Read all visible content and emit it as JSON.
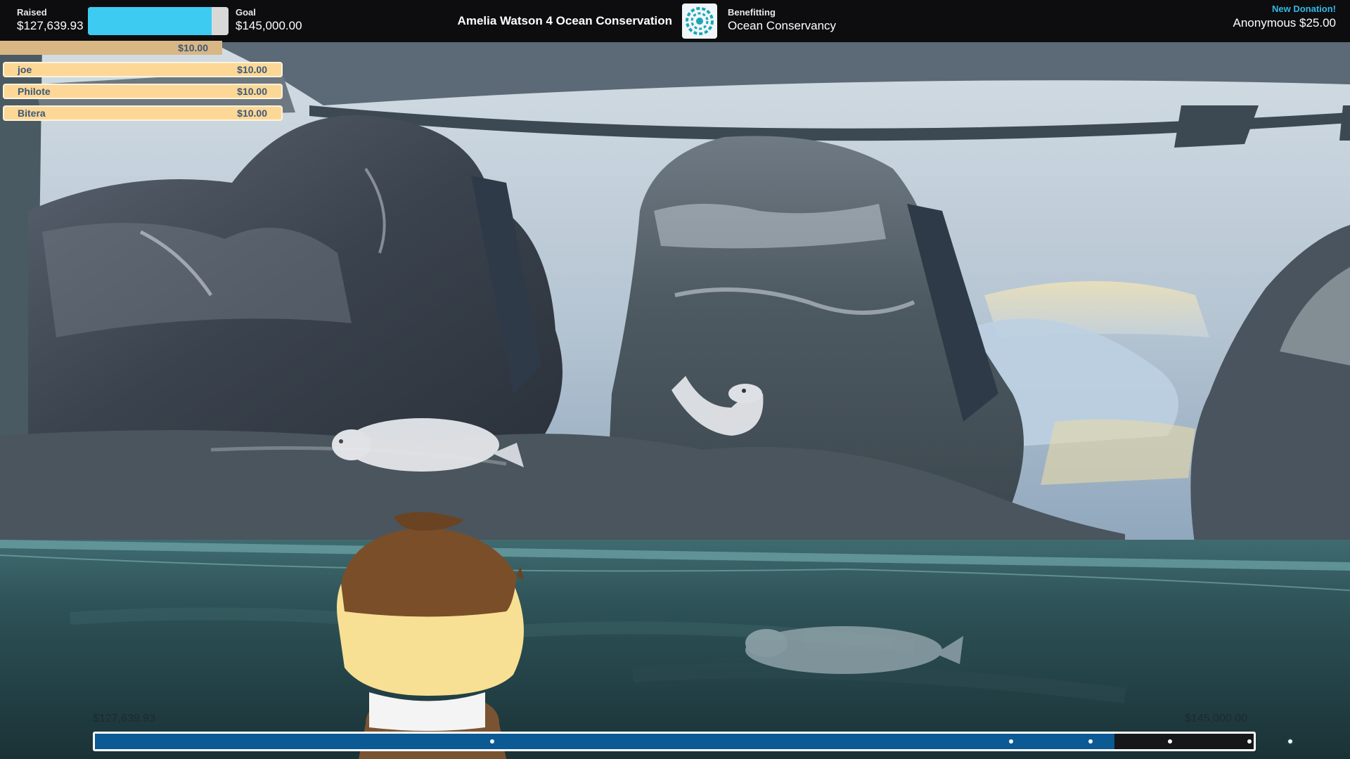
{
  "header": {
    "raised_label": "Raised",
    "raised_value": "$127,639.93",
    "goal_label": "Goal",
    "goal_value": "$145,000.00",
    "progress_fraction": 0.88,
    "stream_title": "Amelia Watson 4 Ocean Conservation",
    "logo_icon": "ocean-conservancy-logo-icon",
    "benefitting_label": "Benefitting",
    "benefitting_value": "Ocean Conservancy",
    "new_donation_label": "New Donation!",
    "new_donation_text": "Anonymous $25.00"
  },
  "donations": {
    "top_amount": "$10.00",
    "items": [
      {
        "name": "joe",
        "amount": "$10.00"
      },
      {
        "name": "Philote",
        "amount": "$10.00"
      },
      {
        "name": "Bitera",
        "amount": "$10.00"
      }
    ]
  },
  "progress": {
    "start_label": "$127,639.93",
    "end_label": "$145,000.00",
    "fill_fraction": 0.88
  },
  "colors": {
    "accent_cyan": "#3ecbf2",
    "progress_blue": "#0b5a94",
    "donation_bg": "#fcd796",
    "donation_text": "#3b5878",
    "new_donation": "#33b8e6"
  }
}
